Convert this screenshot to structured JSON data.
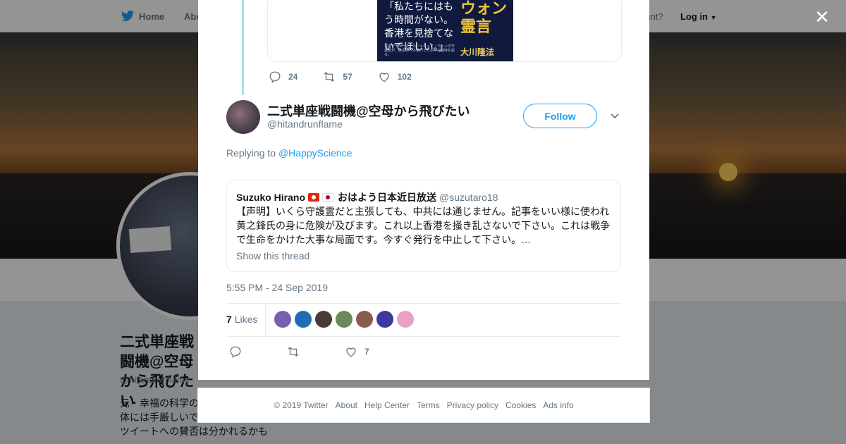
{
  "background": {
    "nav": {
      "home": "Home",
      "about": "Abo",
      "account_prompt": "ccount?",
      "login": "Log in"
    },
    "profile": {
      "name": "二式単座戦闘機@空母から飛びたい",
      "handle": "@hitandrunflame",
      "bio": "元・幸福の科学の… 辞めましたが、実… ト団体には手厳しいです。 基本的に偏屈 なので、ツイートへの賛否は分かれるかも"
    },
    "colors": {
      "banner_dusk": "#b0773c",
      "page_bg": "#e6ecf0"
    }
  },
  "modal": {
    "close_icon": "close-icon",
    "media": {
      "book_quote": "「私たちにはもう時間がない。香港を見捨てないでほしい。」",
      "book_title": "ウォン霊言",
      "book_small": "香港デモリーダーのジョシュア・ウォンの守護霊が、民主化への思いと日本への期待を語る。",
      "book_author": "大川隆法"
    },
    "parent_actions": {
      "replies": "24",
      "retweets": "57",
      "likes": "102"
    },
    "tweet": {
      "author_name": "二式単座戦闘機@空母から飛びたい",
      "author_handle": "@hitandrunflame",
      "follow_label": "Follow",
      "replying_prefix": "Replying to",
      "replying_to": "@HappyScience",
      "quote": {
        "name": "Suzuko Hirano",
        "name2": "おはよう日本近日放送",
        "handle": "@suzutaro18",
        "text": "【声明】いくら守護霊だと主張しても、中共には通じません。記事をいい様に使われ黄之鋒氏の身に危険が及びます。これ以上香港を掻き乱さないで下さい。これは戦争で生命をかけた大事な局面です。今すぐ発行を中止して下さい。…",
        "show_thread": "Show this thread"
      },
      "timestamp": "5:55 PM - 24 Sep 2019",
      "likes_count": "7",
      "likes_label": "Likes",
      "liker_colors": [
        "#7a5fb0",
        "#1f6db5",
        "#4a3a36",
        "#6a8a5a",
        "#8a5a4a",
        "#3a3aa0",
        "#e8a0c8"
      ],
      "actions": {
        "replies": "",
        "retweets": "",
        "likes": "7"
      }
    },
    "accent": "#1da1f2"
  },
  "footer": [
    "© 2019 Twitter",
    "About",
    "Help Center",
    "Terms",
    "Privacy policy",
    "Cookies",
    "Ads info"
  ]
}
